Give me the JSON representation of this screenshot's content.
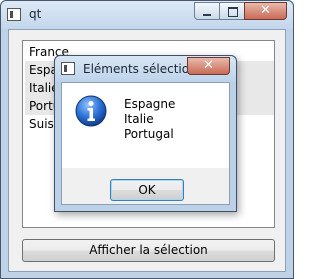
{
  "window": {
    "title": "qt"
  },
  "list": {
    "items": [
      {
        "label": "France",
        "selected": false
      },
      {
        "label": "Espagne",
        "selected": true
      },
      {
        "label": "Italie",
        "selected": true
      },
      {
        "label": "Portugal",
        "selected": true
      },
      {
        "label": "Suisse",
        "selected": false
      }
    ]
  },
  "show_button": {
    "label": "Afficher la sélection"
  },
  "dialog": {
    "title": "Eléments sélectio...",
    "close_label": "x",
    "lines": [
      "Espagne",
      "Italie",
      "Portugal"
    ],
    "ok_label": "OK"
  },
  "colors": {
    "info_icon": "#1f5fbf",
    "close_button": "#c96b56"
  }
}
